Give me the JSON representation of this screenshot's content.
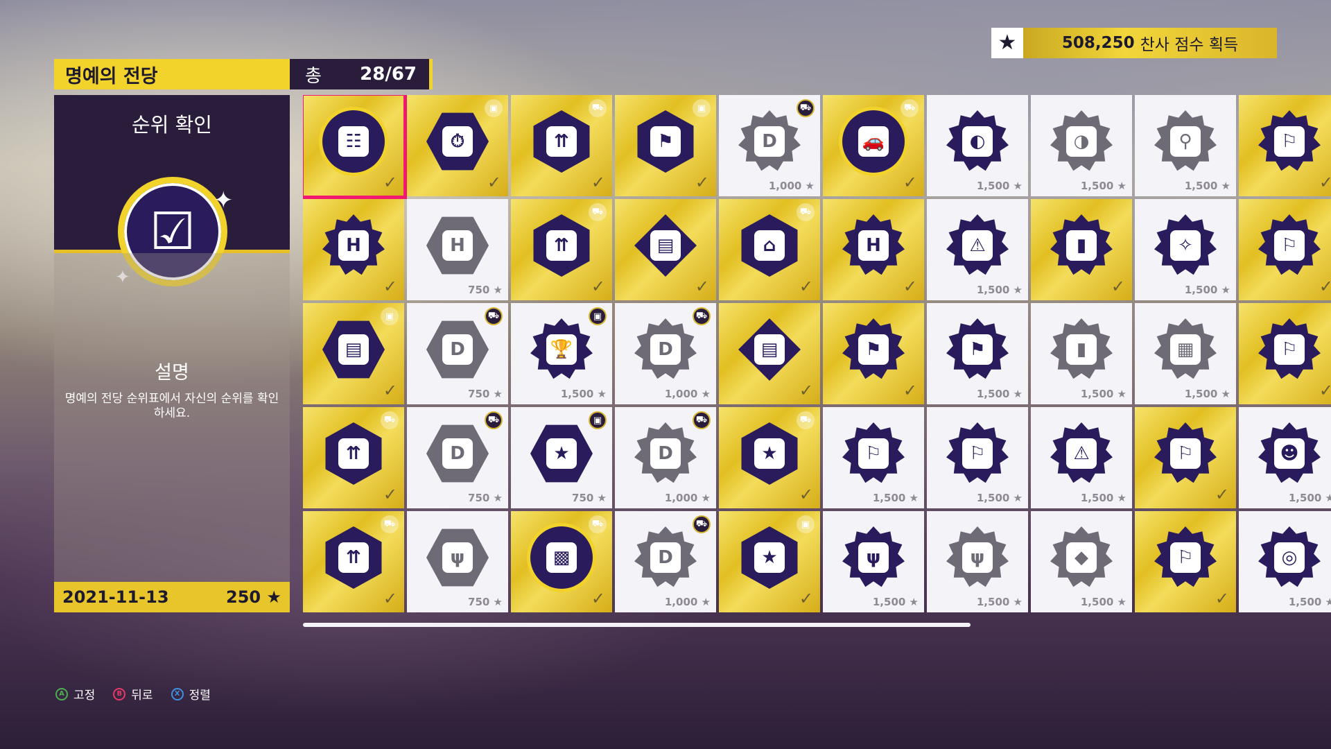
{
  "score": {
    "value": "508,250",
    "suffix": "찬사 점수 획득",
    "star_icon": "star-icon"
  },
  "header": {
    "title": "명예의 전당",
    "total_label": "총",
    "total_count": "28/67"
  },
  "detail": {
    "name": "순위 확인",
    "badge_icon": "clipboard-checklist-icon",
    "desc_title": "설명",
    "desc_text": "명예의 전당 순위표에서 자신의 순위를 확인하세요.",
    "date": "2021-11-13",
    "points": "250"
  },
  "tiles": [
    {
      "state": "gold",
      "shape": "circle",
      "glyph": "☷",
      "icon": "clipboard-icon",
      "corner": "",
      "mark": "✓"
    },
    {
      "state": "gold",
      "shape": "hex",
      "glyph": "⏱",
      "icon": "stopwatch-icon",
      "corner": "gift",
      "mark": "✓"
    },
    {
      "state": "gold",
      "shape": "hexv",
      "glyph": "⇈",
      "icon": "cars-up-icon",
      "corner": "car",
      "mark": "✓"
    },
    {
      "state": "gold",
      "shape": "hexv",
      "glyph": "⚑",
      "icon": "race-flags-icon",
      "corner": "gift",
      "mark": "✓"
    },
    {
      "state": "white",
      "shape": "gear",
      "glyph": "D",
      "icon": "dirt-icon",
      "corner": "car",
      "mark": "1,000 ★"
    },
    {
      "state": "gold",
      "shape": "circle",
      "glyph": "🚗",
      "icon": "car-icon",
      "corner": "car",
      "mark": "✓"
    },
    {
      "state": "white",
      "shape": "gear",
      "glyph": "◐",
      "icon": "cars-crash-icon",
      "corner": "",
      "mark": "1,500 ★",
      "dark": true
    },
    {
      "state": "white",
      "shape": "gear",
      "glyph": "◑",
      "icon": "cars-crash-icon",
      "corner": "",
      "mark": "1,500 ★"
    },
    {
      "state": "white",
      "shape": "gear",
      "glyph": "⚲",
      "icon": "location-pin-icon",
      "corner": "",
      "mark": "1,500 ★"
    },
    {
      "state": "gold",
      "shape": "gear",
      "glyph": "⚐",
      "icon": "flag-icon",
      "corner": "",
      "mark": "✓"
    },
    {
      "state": "gold",
      "shape": "gear",
      "glyph": "H",
      "icon": "helipad-icon",
      "corner": "",
      "mark": "✓"
    },
    {
      "state": "white",
      "shape": "hex",
      "glyph": "H",
      "icon": "gearbox-icon",
      "corner": "",
      "mark": "750 ★"
    },
    {
      "state": "gold",
      "shape": "hexv",
      "glyph": "⇈",
      "icon": "cars-up-icon",
      "corner": "car",
      "mark": "✓"
    },
    {
      "state": "gold",
      "shape": "diamond",
      "glyph": "▤",
      "icon": "book-icon",
      "corner": "",
      "mark": "✓"
    },
    {
      "state": "gold",
      "shape": "hexv",
      "glyph": "⌂",
      "icon": "house-icon",
      "corner": "car",
      "mark": "✓"
    },
    {
      "state": "gold",
      "shape": "gear",
      "glyph": "H",
      "icon": "helipad-icon",
      "corner": "",
      "mark": "✓"
    },
    {
      "state": "white",
      "shape": "gear",
      "glyph": "⚠",
      "icon": "warning-icon",
      "corner": "",
      "mark": "1,500 ★",
      "dark": true
    },
    {
      "state": "gold",
      "shape": "gear",
      "glyph": "▮",
      "icon": "speed-camera-icon",
      "corner": "",
      "mark": "✓"
    },
    {
      "state": "white",
      "shape": "gear",
      "glyph": "✧",
      "icon": "compass-icon",
      "corner": "",
      "mark": "1,500 ★",
      "dark": true
    },
    {
      "state": "gold",
      "shape": "gear",
      "glyph": "⚐",
      "icon": "flag-icon",
      "corner": "",
      "mark": "✓"
    },
    {
      "state": "gold",
      "shape": "hex",
      "glyph": "▤",
      "icon": "book-icon",
      "corner": "gift",
      "mark": "✓"
    },
    {
      "state": "white",
      "shape": "hex",
      "glyph": "D",
      "icon": "dirt-icon",
      "corner": "car",
      "mark": "750 ★"
    },
    {
      "state": "white",
      "shape": "gear",
      "glyph": "🏆",
      "icon": "trophy-icon",
      "corner": "gift",
      "mark": "1,500 ★",
      "dark": true
    },
    {
      "state": "white",
      "shape": "gear",
      "glyph": "D",
      "icon": "dirt-icon",
      "corner": "car",
      "mark": "1,000 ★"
    },
    {
      "state": "gold",
      "shape": "diamond",
      "glyph": "▤",
      "icon": "book-icon",
      "corner": "",
      "mark": "✓"
    },
    {
      "state": "gold",
      "shape": "gear",
      "glyph": "⚑",
      "icon": "checkered-flag-icon",
      "corner": "",
      "mark": "✓"
    },
    {
      "state": "white",
      "shape": "gear",
      "glyph": "⚑",
      "icon": "checkered-flag-icon",
      "corner": "",
      "mark": "1,500 ★",
      "dark": true
    },
    {
      "state": "white",
      "shape": "gear",
      "glyph": "▮",
      "icon": "speed-camera-icon",
      "corner": "",
      "mark": "1,500 ★"
    },
    {
      "state": "white",
      "shape": "gear",
      "glyph": "▦",
      "icon": "calendar-icon",
      "corner": "",
      "mark": "1,500 ★"
    },
    {
      "state": "gold",
      "shape": "gear",
      "glyph": "⚐",
      "icon": "flag-icon",
      "corner": "",
      "mark": "✓"
    },
    {
      "state": "gold",
      "shape": "hexv",
      "glyph": "⇈",
      "icon": "cars-up-icon",
      "corner": "car",
      "mark": "✓"
    },
    {
      "state": "white",
      "shape": "hex",
      "glyph": "D",
      "icon": "dirt-icon",
      "corner": "car",
      "mark": "750 ★"
    },
    {
      "state": "white",
      "shape": "hex",
      "glyph": "★",
      "icon": "stars-icon",
      "corner": "gift",
      "mark": "750 ★",
      "dark": true
    },
    {
      "state": "white",
      "shape": "gear",
      "glyph": "D",
      "icon": "dirt-icon",
      "corner": "car",
      "mark": "1,000 ★"
    },
    {
      "state": "gold",
      "shape": "hexv",
      "glyph": "★",
      "icon": "stars-icon",
      "corner": "car",
      "mark": "✓"
    },
    {
      "state": "white",
      "shape": "gear",
      "glyph": "⚐",
      "icon": "flag-icon",
      "corner": "",
      "mark": "1,500 ★",
      "dark": true
    },
    {
      "state": "white",
      "shape": "gear",
      "glyph": "⚐",
      "icon": "flag-icon",
      "corner": "",
      "mark": "1,500 ★",
      "dark": true
    },
    {
      "state": "white",
      "shape": "gear",
      "glyph": "⚠",
      "icon": "warning-icon",
      "corner": "",
      "mark": "1,500 ★",
      "dark": true
    },
    {
      "state": "gold",
      "shape": "gear",
      "glyph": "⚐",
      "icon": "flag-icon",
      "corner": "",
      "mark": "✓"
    },
    {
      "state": "white",
      "shape": "gear",
      "glyph": "☻",
      "icon": "luchador-mask-icon",
      "corner": "",
      "mark": "1,500 ★",
      "dark": true
    },
    {
      "state": "gold",
      "shape": "hexv",
      "glyph": "⇈",
      "icon": "cars-up-icon",
      "corner": "car",
      "mark": "✓"
    },
    {
      "state": "white",
      "shape": "hex",
      "glyph": "ψ",
      "icon": "cactus-icon",
      "corner": "",
      "mark": "750 ★"
    },
    {
      "state": "gold",
      "shape": "circle",
      "glyph": "▩",
      "icon": "race-finish-icon",
      "corner": "car",
      "mark": "✓"
    },
    {
      "state": "white",
      "shape": "gear",
      "glyph": "D",
      "icon": "dirt-icon",
      "corner": "car",
      "mark": "1,000 ★"
    },
    {
      "state": "gold",
      "shape": "hexv",
      "glyph": "★",
      "icon": "stars-icon",
      "corner": "gift",
      "mark": "✓"
    },
    {
      "state": "white",
      "shape": "gear",
      "glyph": "ψ",
      "icon": "cactus-icon",
      "corner": "",
      "mark": "1,500 ★",
      "dark": true
    },
    {
      "state": "white",
      "shape": "gear",
      "glyph": "ψ",
      "icon": "cactus-icon",
      "corner": "",
      "mark": "1,500 ★"
    },
    {
      "state": "white",
      "shape": "gear",
      "glyph": "◆",
      "icon": "car-drift-icon",
      "corner": "",
      "mark": "1,500 ★"
    },
    {
      "state": "gold",
      "shape": "gear",
      "glyph": "⚐",
      "icon": "flag-icon",
      "corner": "",
      "mark": "✓"
    },
    {
      "state": "white",
      "shape": "gear",
      "glyph": "◎",
      "icon": "camera-icon",
      "corner": "",
      "mark": "1,500 ★",
      "dark": true
    }
  ],
  "controls": [
    {
      "key": "A",
      "label": "고정",
      "color": "#4caf50"
    },
    {
      "key": "B",
      "label": "뒤로",
      "color": "#e53968"
    },
    {
      "key": "X",
      "label": "정렬",
      "color": "#3f8fe0"
    }
  ]
}
